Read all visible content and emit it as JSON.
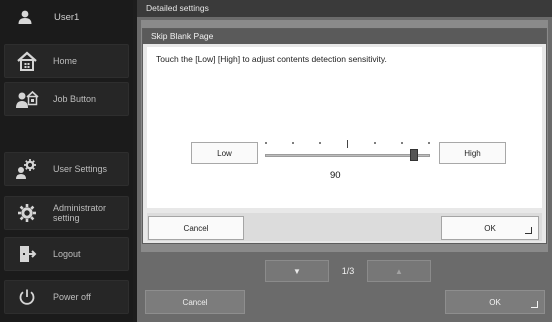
{
  "user": {
    "name": "User1",
    "icon": "user-icon"
  },
  "sidebar": {
    "items": [
      {
        "label": "Home",
        "icon": "home-icon"
      },
      {
        "label": "Job Button",
        "icon": "job-button-icon"
      },
      {
        "label": "User Settings",
        "icon": "user-settings-icon"
      },
      {
        "label": "Administrator setting",
        "icon": "admin-gear-icon"
      },
      {
        "label": "Logout",
        "icon": "logout-icon"
      },
      {
        "label": "Power off",
        "icon": "power-icon"
      }
    ]
  },
  "screen": {
    "title": "Detailed settings",
    "pager": {
      "down_icon": "▼",
      "up_icon": "▲",
      "page": "1/3"
    },
    "cancel_label": "Cancel",
    "ok_label": "OK"
  },
  "dialog": {
    "title": "Skip Blank Page",
    "message": "Touch the [Low] [High] to adjust contents detection sensitivity.",
    "low_label": "Low",
    "high_label": "High",
    "slider_value": "90",
    "cancel_label": "Cancel",
    "ok_label": "OK"
  },
  "colors": {
    "sidebar_bg": "#1b1b1b",
    "panel_bg": "#6b6b6b",
    "dialog_bg": "#e8e8e8",
    "title_bar": "#5a5a5a"
  }
}
